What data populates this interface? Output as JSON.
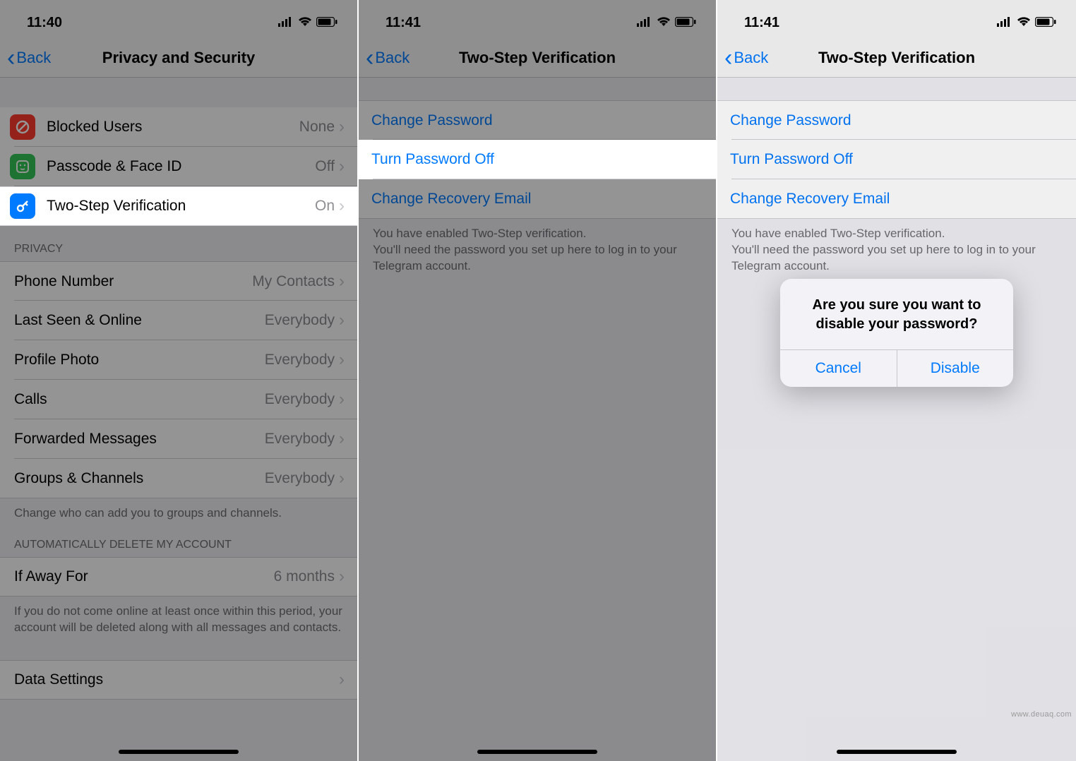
{
  "screens": [
    {
      "status": {
        "time": "11:40"
      },
      "nav": {
        "back": "Back",
        "title": "Privacy and Security"
      },
      "security": [
        {
          "label": "Blocked Users",
          "value": "None",
          "icon": "block-icon"
        },
        {
          "label": "Passcode & Face ID",
          "value": "Off",
          "icon": "faceid-icon"
        },
        {
          "label": "Two-Step Verification",
          "value": "On",
          "icon": "key-icon"
        }
      ],
      "privacy_header": "PRIVACY",
      "privacy": [
        {
          "label": "Phone Number",
          "value": "My Contacts"
        },
        {
          "label": "Last Seen & Online",
          "value": "Everybody"
        },
        {
          "label": "Profile Photo",
          "value": "Everybody"
        },
        {
          "label": "Calls",
          "value": "Everybody"
        },
        {
          "label": "Forwarded Messages",
          "value": "Everybody"
        },
        {
          "label": "Groups & Channels",
          "value": "Everybody"
        }
      ],
      "privacy_footer": "Change who can add you to groups and channels.",
      "autodelete_header": "AUTOMATICALLY DELETE MY ACCOUNT",
      "autodelete": {
        "label": "If Away For",
        "value": "6 months"
      },
      "autodelete_footer": "If you do not come online at least once within this period, your account will be deleted along with all messages and contacts.",
      "data_settings_label": "Data Settings"
    },
    {
      "status": {
        "time": "11:41"
      },
      "nav": {
        "back": "Back",
        "title": "Two-Step Verification"
      },
      "options": [
        "Change Password",
        "Turn Password Off",
        "Change Recovery Email"
      ],
      "footer": "You have enabled Two-Step verification.\nYou'll need the password you set up here to log in to your Telegram account."
    },
    {
      "status": {
        "time": "11:41"
      },
      "nav": {
        "back": "Back",
        "title": "Two-Step Verification"
      },
      "options": [
        "Change Password",
        "Turn Password Off",
        "Change Recovery Email"
      ],
      "footer": "You have enabled Two-Step verification.\nYou'll need the password you set up here to log in to your Telegram account.",
      "alert": {
        "message": "Are you sure you want to disable your password?",
        "cancel": "Cancel",
        "confirm": "Disable"
      }
    }
  ],
  "watermark": "www.deuaq.com"
}
